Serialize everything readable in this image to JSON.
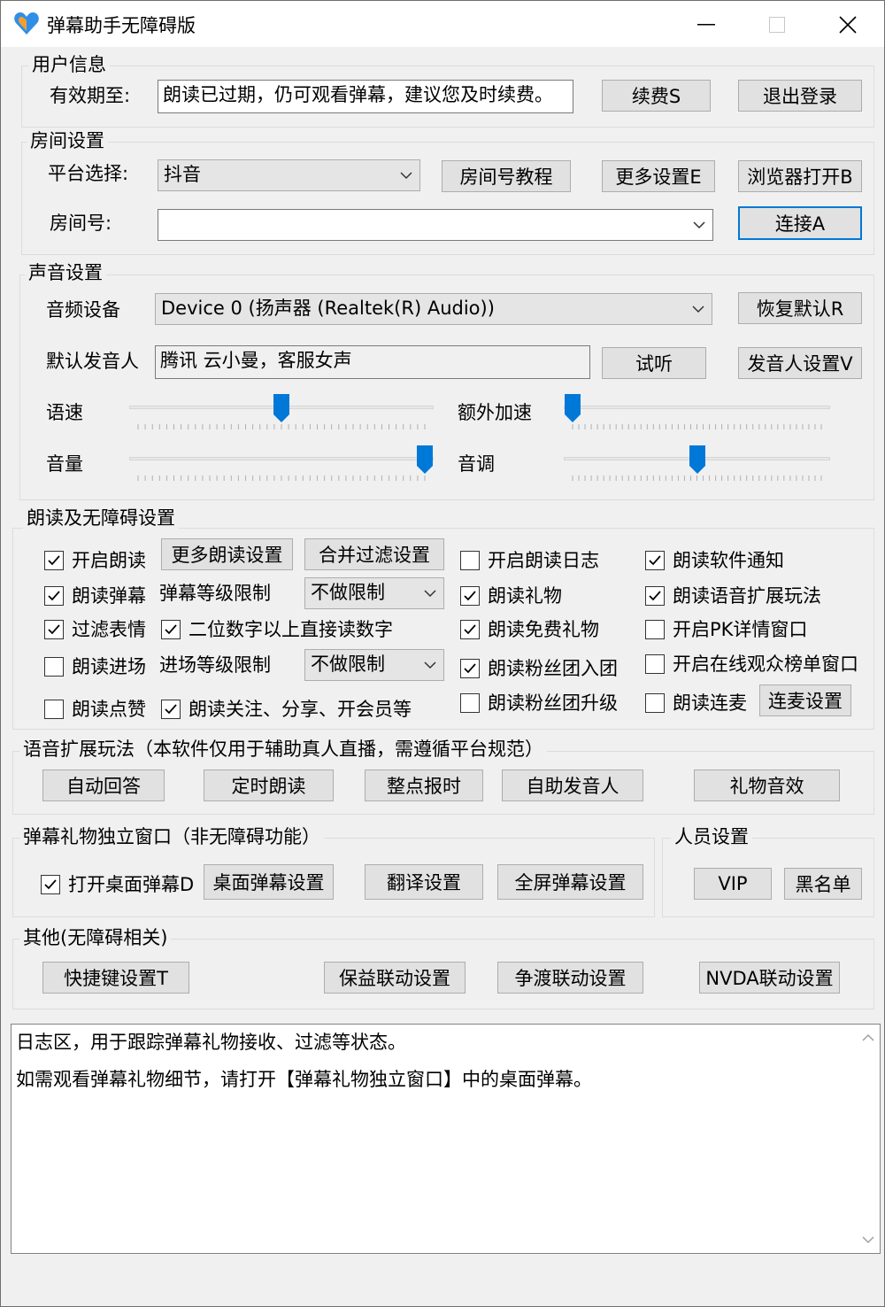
{
  "window": {
    "title": "弹幕助手无障碍版"
  },
  "user_info": {
    "group_label": "用户信息",
    "validity_label": "有效期至:",
    "validity_value": "朗读已过期，仍可观看弹幕，建议您及时续费。",
    "renew_button": "续费S",
    "logout_button": "退出登录"
  },
  "room": {
    "group_label": "房间设置",
    "platform_label": "平台选择:",
    "platform_value": "抖音",
    "room_tutorial_button": "房间号教程",
    "more_settings_button": "更多设置E",
    "browser_open_button": "浏览器打开B",
    "room_label": "房间号:",
    "room_value": "",
    "connect_button": "连接A"
  },
  "sound": {
    "group_label": "声音设置",
    "device_label": "音频设备",
    "device_value": "Device 0 (扬声器 (Realtek(R) Audio))",
    "restore_button": "恢复默认R",
    "voice_label": "默认发音人",
    "voice_value": "腾讯 云小曼，客服女声",
    "listen_button": "试听",
    "voice_settings_button": "发音人设置V",
    "speed_label": "语速",
    "speed_value": 0.5,
    "extra_speed_label": "额外加速",
    "extra_speed_value": 0.0,
    "volume_label": "音量",
    "volume_value": 1.0,
    "pitch_label": "音调",
    "pitch_value": 0.5
  },
  "reading": {
    "group_label": "朗读及无障碍设置",
    "enable_reading": {
      "label": "开启朗读",
      "checked": true
    },
    "more_reading_button": "更多朗读设置",
    "merge_filter_button": "合并过滤设置",
    "reading_log": {
      "label": "开启朗读日志",
      "checked": false
    },
    "software_notice": {
      "label": "朗读软件通知",
      "checked": true
    },
    "read_danmaku": {
      "label": "朗读弹幕",
      "checked": true
    },
    "danmaku_level_label": "弹幕等级限制",
    "danmaku_level_value": "不做限制",
    "read_gift": {
      "label": "朗读礼物",
      "checked": true
    },
    "voice_extension": {
      "label": "朗读语音扩展玩法",
      "checked": true
    },
    "filter_emoji": {
      "label": "过滤表情",
      "checked": true
    },
    "digits_direct": {
      "label": "二位数字以上直接读数字",
      "checked": true
    },
    "read_free_gift": {
      "label": "朗读免费礼物",
      "checked": true
    },
    "pk_window": {
      "label": "开启PK详情窗口",
      "checked": false
    },
    "read_enter": {
      "label": "朗读进场",
      "checked": false
    },
    "enter_level_label": "进场等级限制",
    "enter_level_value": "不做限制",
    "read_fan_join": {
      "label": "朗读粉丝团入团",
      "checked": true
    },
    "online_rank_window": {
      "label": "开启在线观众榜单窗口",
      "checked": false
    },
    "read_like": {
      "label": "朗读点赞",
      "checked": false
    },
    "read_follow": {
      "label": "朗读关注、分享、开会员等",
      "checked": true
    },
    "read_fan_upgrade": {
      "label": "朗读粉丝团升级",
      "checked": false
    },
    "read_mic": {
      "label": "朗读连麦",
      "checked": false
    },
    "mic_settings_button": "连麦设置"
  },
  "voice_ext": {
    "group_label": "语音扩展玩法（本软件仅用于辅助真人直播，需遵循平台规范）",
    "auto_reply_button": "自动回答",
    "timed_read_button": "定时朗读",
    "hourly_button": "整点报时",
    "self_voice_button": "自助发音人",
    "gift_sound_button": "礼物音效"
  },
  "danmaku_window": {
    "group_label": "弹幕礼物独立窗口（非无障碍功能）",
    "desktop_danmaku": {
      "label": "打开桌面弹幕D",
      "checked": true
    },
    "desktop_settings_button": "桌面弹幕设置",
    "translate_button": "翻译设置",
    "fullscreen_button": "全屏弹幕设置"
  },
  "people": {
    "group_label": "人员设置",
    "vip_button": "VIP",
    "blacklist_button": "黑名单"
  },
  "other": {
    "group_label": "其他(无障碍相关)",
    "hotkey_button": "快捷键设置T",
    "baoyi_button": "保益联动设置",
    "zhengdu_button": "争渡联动设置",
    "nvda_button": "NVDA联动设置"
  },
  "log": {
    "line1": "日志区，用于跟踪弹幕礼物接收、过滤等状态。",
    "line2": "如需观看弹幕礼物细节，请打开【弹幕礼物独立窗口】中的桌面弹幕。"
  },
  "colors": {
    "accent": "#0078d7",
    "button_bg": "#e1e1e1",
    "window_bg": "#f0f0f0"
  }
}
